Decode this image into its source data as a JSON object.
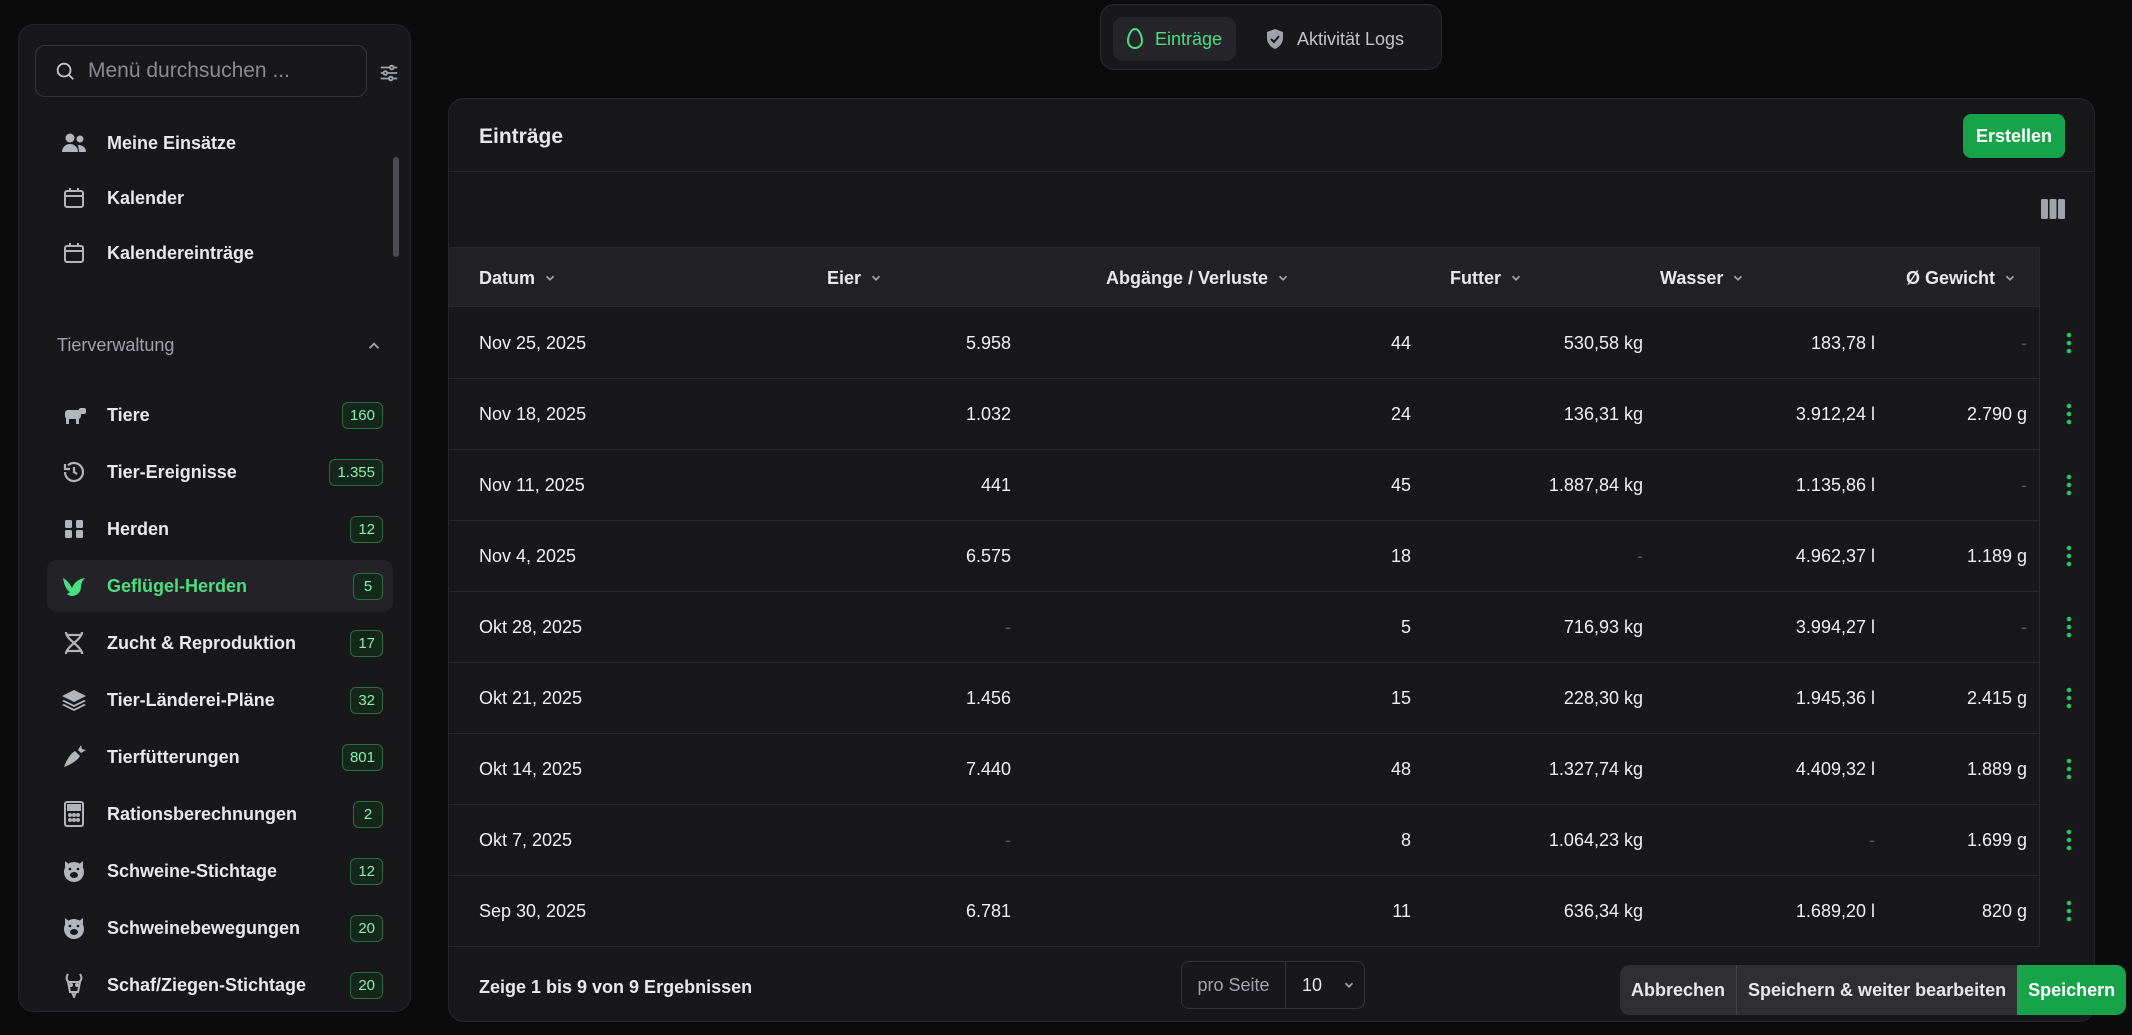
{
  "sidebar": {
    "search_placeholder": "Menü durchsuchen ...",
    "items_top": [
      {
        "label": "Meine Einsätze",
        "icon": "users-icon"
      },
      {
        "label": "Kalender",
        "icon": "calendar-icon"
      },
      {
        "label": "Kalendereinträge",
        "icon": "calendar-icon"
      }
    ],
    "group": "Tierverwaltung",
    "items": [
      {
        "label": "Tiere",
        "badge": "160",
        "icon": "cow-icon"
      },
      {
        "label": "Tier-Ereignisse",
        "badge": "1.355",
        "icon": "history-icon"
      },
      {
        "label": "Herden",
        "badge": "12",
        "icon": "herd-icon"
      },
      {
        "label": "Geflügel-Herden",
        "badge": "5",
        "icon": "bird-icon",
        "active": true
      },
      {
        "label": "Zucht & Reproduktion",
        "badge": "17",
        "icon": "dna-icon"
      },
      {
        "label": "Tier-Länderei-Pläne",
        "badge": "32",
        "icon": "layers-icon"
      },
      {
        "label": "Tierfütterungen",
        "badge": "801",
        "icon": "carrot-icon"
      },
      {
        "label": "Rationsberechnungen",
        "badge": "2",
        "icon": "calculator-icon"
      },
      {
        "label": "Schweine-Stichtage",
        "badge": "12",
        "icon": "pig-icon"
      },
      {
        "label": "Schweinebewegungen",
        "badge": "20",
        "icon": "pig-icon"
      },
      {
        "label": "Schaf/Ziegen-Stichtage",
        "badge": "20",
        "icon": "goat-icon"
      }
    ]
  },
  "topnav": {
    "tabs": [
      {
        "label": "Einträge",
        "icon": "egg-icon",
        "active": true
      },
      {
        "label": "Aktivität Logs",
        "icon": "shield-icon",
        "active": false
      }
    ]
  },
  "panel": {
    "title": "Einträge",
    "create_label": "Erstellen"
  },
  "table": {
    "headers": [
      "Datum",
      "Eier",
      "Abgänge / Verluste",
      "Futter",
      "Wasser",
      "Ø Gewicht"
    ],
    "rows": [
      [
        "Nov 25, 2025",
        "5.958",
        "44",
        "530,58 kg",
        "183,78 l",
        "-"
      ],
      [
        "Nov 18, 2025",
        "1.032",
        "24",
        "136,31 kg",
        "3.912,24 l",
        "2.790 g"
      ],
      [
        "Nov 11, 2025",
        "441",
        "45",
        "1.887,84 kg",
        "1.135,86 l",
        "-"
      ],
      [
        "Nov 4, 2025",
        "6.575",
        "18",
        "-",
        "4.962,37 l",
        "1.189 g"
      ],
      [
        "Okt 28, 2025",
        "-",
        "5",
        "716,93 kg",
        "3.994,27 l",
        "-"
      ],
      [
        "Okt 21, 2025",
        "1.456",
        "15",
        "228,30 kg",
        "1.945,36 l",
        "2.415 g"
      ],
      [
        "Okt 14, 2025",
        "7.440",
        "48",
        "1.327,74 kg",
        "4.409,32 l",
        "1.889 g"
      ],
      [
        "Okt 7, 2025",
        "-",
        "8",
        "1.064,23 kg",
        "-",
        "1.699 g"
      ],
      [
        "Sep 30, 2025",
        "6.781",
        "11",
        "636,34 kg",
        "1.689,20 l",
        "820 g"
      ]
    ]
  },
  "footer": {
    "summary": "Zeige 1 bis 9 von 9 Ergebnissen",
    "per_page_label": "pro Seite",
    "per_page_value": "10"
  },
  "actionbar": {
    "cancel": "Abbrechen",
    "save_continue": "Speichern & weiter bearbeiten",
    "save": "Speichern"
  },
  "colors": {
    "accent": "#16a34a",
    "active_text": "#4ade80",
    "background": "#0b0b0c",
    "panel": "#18181b"
  }
}
